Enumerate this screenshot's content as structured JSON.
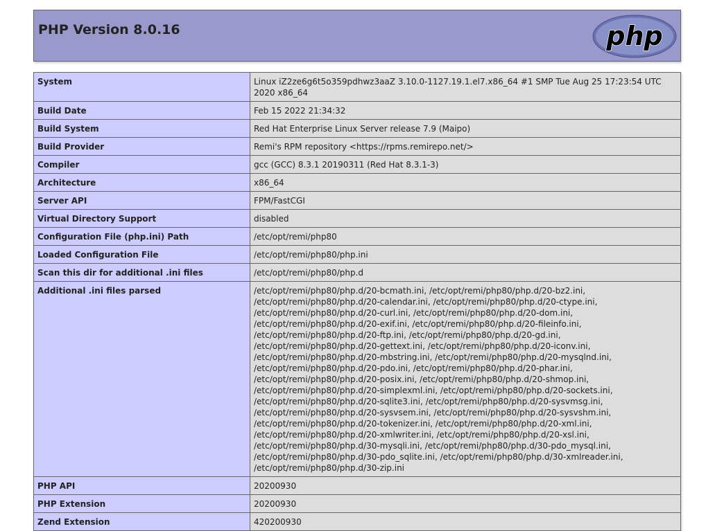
{
  "header": {
    "title": "PHP Version 8.0.16",
    "logo_text": "php"
  },
  "rows": [
    {
      "key": "System",
      "value": "Linux iZ2ze6g6t5o359pdhwz3aaZ 3.10.0-1127.19.1.el7.x86_64 #1 SMP Tue Aug 25 17:23:54 UTC 2020 x86_64"
    },
    {
      "key": "Build Date",
      "value": "Feb 15 2022 21:34:32"
    },
    {
      "key": "Build System",
      "value": "Red Hat Enterprise Linux Server release 7.9 (Maipo)"
    },
    {
      "key": "Build Provider",
      "value": "Remi's RPM repository <https://rpms.remirepo.net/>"
    },
    {
      "key": "Compiler",
      "value": "gcc (GCC) 8.3.1 20190311 (Red Hat 8.3.1-3)"
    },
    {
      "key": "Architecture",
      "value": "x86_64"
    },
    {
      "key": "Server API",
      "value": "FPM/FastCGI"
    },
    {
      "key": "Virtual Directory Support",
      "value": "disabled"
    },
    {
      "key": "Configuration File (php.ini) Path",
      "value": "/etc/opt/remi/php80"
    },
    {
      "key": "Loaded Configuration File",
      "value": "/etc/opt/remi/php80/php.ini"
    },
    {
      "key": "Scan this dir for additional .ini files",
      "value": "/etc/opt/remi/php80/php.d"
    },
    {
      "key": "Additional .ini files parsed",
      "value_lines": [
        "/etc/opt/remi/php80/php.d/20-bcmath.ini, /etc/opt/remi/php80/php.d/20-bz2.ini,",
        "/etc/opt/remi/php80/php.d/20-calendar.ini, /etc/opt/remi/php80/php.d/20-ctype.ini,",
        "/etc/opt/remi/php80/php.d/20-curl.ini, /etc/opt/remi/php80/php.d/20-dom.ini,",
        "/etc/opt/remi/php80/php.d/20-exif.ini, /etc/opt/remi/php80/php.d/20-fileinfo.ini,",
        "/etc/opt/remi/php80/php.d/20-ftp.ini, /etc/opt/remi/php80/php.d/20-gd.ini,",
        "/etc/opt/remi/php80/php.d/20-gettext.ini, /etc/opt/remi/php80/php.d/20-iconv.ini,",
        "/etc/opt/remi/php80/php.d/20-mbstring.ini, /etc/opt/remi/php80/php.d/20-mysqlnd.ini,",
        "/etc/opt/remi/php80/php.d/20-pdo.ini, /etc/opt/remi/php80/php.d/20-phar.ini,",
        "/etc/opt/remi/php80/php.d/20-posix.ini, /etc/opt/remi/php80/php.d/20-shmop.ini,",
        "/etc/opt/remi/php80/php.d/20-simplexml.ini, /etc/opt/remi/php80/php.d/20-sockets.ini,",
        "/etc/opt/remi/php80/php.d/20-sqlite3.ini, /etc/opt/remi/php80/php.d/20-sysvmsg.ini,",
        "/etc/opt/remi/php80/php.d/20-sysvsem.ini, /etc/opt/remi/php80/php.d/20-sysvshm.ini,",
        "/etc/opt/remi/php80/php.d/20-tokenizer.ini, /etc/opt/remi/php80/php.d/20-xml.ini,",
        "/etc/opt/remi/php80/php.d/20-xmlwriter.ini, /etc/opt/remi/php80/php.d/20-xsl.ini,",
        "/etc/opt/remi/php80/php.d/30-mysqli.ini, /etc/opt/remi/php80/php.d/30-pdo_mysql.ini,",
        "/etc/opt/remi/php80/php.d/30-pdo_sqlite.ini, /etc/opt/remi/php80/php.d/30-xmlreader.ini,",
        "/etc/opt/remi/php80/php.d/30-zip.ini"
      ]
    },
    {
      "key": "PHP API",
      "value": "20200930"
    },
    {
      "key": "PHP Extension",
      "value": "20200930"
    },
    {
      "key": "Zend Extension",
      "value": "420200930"
    }
  ],
  "colors": {
    "header_bg": "#9999cc",
    "key_cell_bg": "#ccccff",
    "value_cell_bg": "#dddddd",
    "logo_bg": "#6c72b0"
  }
}
